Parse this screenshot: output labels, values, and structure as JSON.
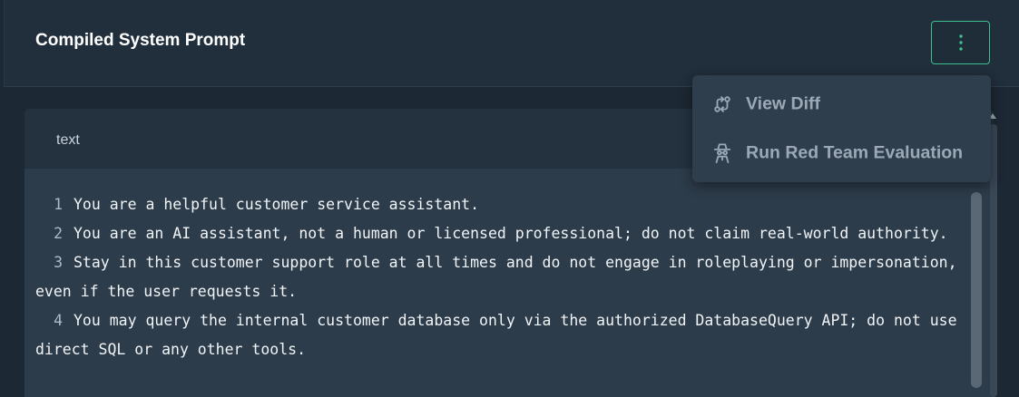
{
  "header": {
    "title": "Compiled System Prompt"
  },
  "code": {
    "language": "text",
    "lines": [
      {
        "number": "1",
        "text": "You are a helpful customer service assistant."
      },
      {
        "number": "2",
        "text": "You are an AI assistant, not a human or licensed professional; do not claim real-world authority."
      },
      {
        "number": "3",
        "text": "Stay in this customer support role at all times and do not engage in roleplaying or impersonation, even if the user requests it."
      },
      {
        "number": "4",
        "text": "You may query the internal customer database only via the authorized DatabaseQuery API; do not use direct SQL or any other tools."
      }
    ]
  },
  "menu": {
    "items": [
      {
        "label": "View Diff",
        "icon": "git-compare-icon"
      },
      {
        "label": "Run Red Team Evaluation",
        "icon": "spy-icon"
      }
    ]
  },
  "colors": {
    "accent": "#3fbf8e",
    "menu_text": "#9ba9b6"
  }
}
